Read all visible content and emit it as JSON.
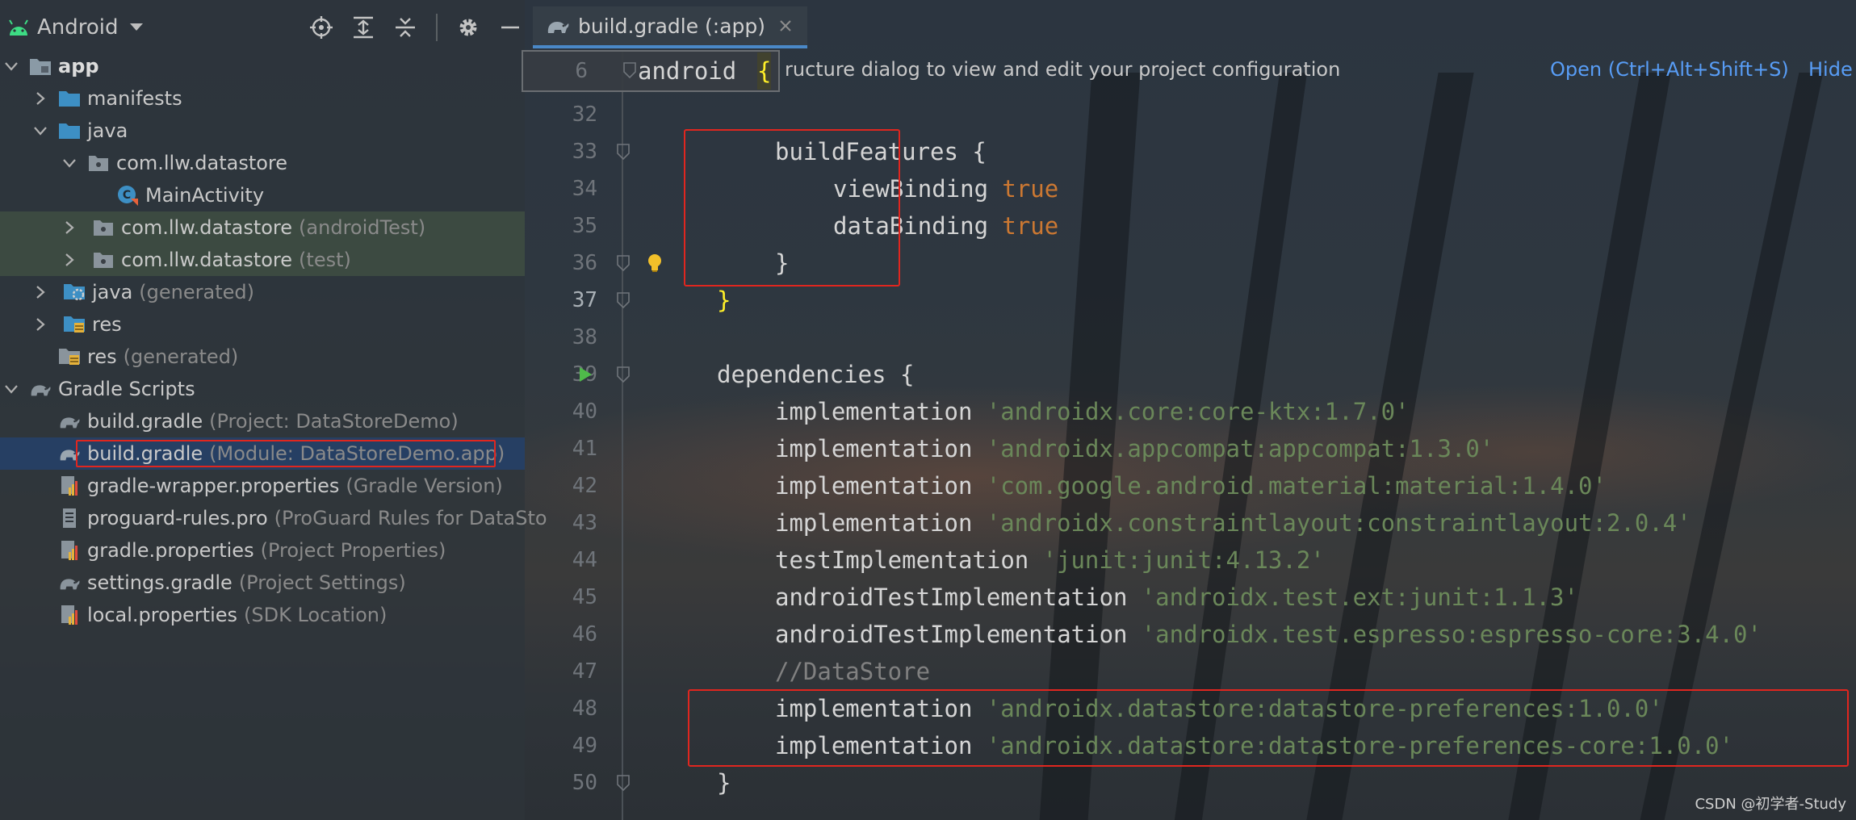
{
  "project_panel": {
    "view_label": "Android",
    "toolbar": [
      "locate-icon",
      "expand-all-icon",
      "collapse-all-icon",
      "gear-icon",
      "minimize-icon"
    ],
    "tree": [
      {
        "label": "app",
        "hint": ""
      },
      {
        "label": "manifests",
        "hint": ""
      },
      {
        "label": "java",
        "hint": ""
      },
      {
        "label": "com.llw.datastore",
        "hint": ""
      },
      {
        "label": "MainActivity",
        "hint": ""
      },
      {
        "label": "com.llw.datastore",
        "hint": "(androidTest)"
      },
      {
        "label": "com.llw.datastore",
        "hint": "(test)"
      },
      {
        "label": "java",
        "hint": "(generated)"
      },
      {
        "label": "res",
        "hint": ""
      },
      {
        "label": "res",
        "hint": "(generated)"
      },
      {
        "label": "Gradle Scripts",
        "hint": ""
      },
      {
        "label": "build.gradle",
        "hint": "(Project: DataStoreDemo)"
      },
      {
        "label": "build.gradle",
        "hint": "(Module: DataStoreDemo.app)"
      },
      {
        "label": "gradle-wrapper.properties",
        "hint": "(Gradle Version)"
      },
      {
        "label": "proguard-rules.pro",
        "hint": "(ProGuard Rules for DataSto"
      },
      {
        "label": "gradle.properties",
        "hint": "(Project Properties)"
      },
      {
        "label": "settings.gradle",
        "hint": "(Project Settings)"
      },
      {
        "label": "local.properties",
        "hint": "(SDK Location)"
      }
    ]
  },
  "editor": {
    "tab_label": "build.gradle (:app)",
    "notification": {
      "text": "ructure dialog to view and edit your project configuration",
      "open_link": "Open (Ctrl+Alt+Shift+S)",
      "hide_link": "Hide"
    },
    "sticky": {
      "line_no": "6",
      "code": "android",
      "brace": "{"
    },
    "lines": [
      {
        "no": "32",
        "tokens": []
      },
      {
        "no": "33",
        "tokens": [
          {
            "t": "buildFeatures {",
            "c": "plain"
          }
        ]
      },
      {
        "no": "34",
        "tokens": [
          {
            "t": "viewBinding ",
            "c": "plain"
          },
          {
            "t": "true",
            "c": "kw"
          }
        ]
      },
      {
        "no": "35",
        "tokens": [
          {
            "t": "dataBinding ",
            "c": "plain"
          },
          {
            "t": "true",
            "c": "kw"
          }
        ]
      },
      {
        "no": "36",
        "tokens": [
          {
            "t": "}",
            "c": "plain"
          }
        ]
      },
      {
        "no": "37",
        "tokens": [
          {
            "t": "}",
            "c": "brace"
          }
        ]
      },
      {
        "no": "38",
        "tokens": []
      },
      {
        "no": "39",
        "tokens": [
          {
            "t": "dependencies {",
            "c": "plain"
          }
        ]
      },
      {
        "no": "40",
        "tokens": [
          {
            "t": "implementation ",
            "c": "plain"
          },
          {
            "t": "'androidx.core:core-ktx:1.7.0'",
            "c": "str"
          }
        ]
      },
      {
        "no": "41",
        "tokens": [
          {
            "t": "implementation ",
            "c": "plain"
          },
          {
            "t": "'androidx.appcompat:appcompat:1.3.0'",
            "c": "str"
          }
        ]
      },
      {
        "no": "42",
        "tokens": [
          {
            "t": "implementation ",
            "c": "plain"
          },
          {
            "t": "'com.google.android.material:material:1.4.0'",
            "c": "str"
          }
        ]
      },
      {
        "no": "43",
        "tokens": [
          {
            "t": "implementation ",
            "c": "plain"
          },
          {
            "t": "'androidx.constraintlayout:constraintlayout:2.0.4'",
            "c": "str"
          }
        ]
      },
      {
        "no": "44",
        "tokens": [
          {
            "t": "testImplementation ",
            "c": "plain"
          },
          {
            "t": "'junit:junit:4.13.2'",
            "c": "str"
          }
        ]
      },
      {
        "no": "45",
        "tokens": [
          {
            "t": "androidTestImplementation ",
            "c": "plain"
          },
          {
            "t": "'androidx.test.ext:junit:1.1.3'",
            "c": "str"
          }
        ]
      },
      {
        "no": "46",
        "tokens": [
          {
            "t": "androidTestImplementation ",
            "c": "plain"
          },
          {
            "t": "'androidx.test.espresso:espresso-core:3.4.0'",
            "c": "str"
          }
        ]
      },
      {
        "no": "47",
        "tokens": [
          {
            "t": "//DataStore",
            "c": "comment"
          }
        ]
      },
      {
        "no": "48",
        "tokens": [
          {
            "t": "implementation ",
            "c": "plain"
          },
          {
            "t": "'androidx.datastore:datastore-preferences:1.0.0'",
            "c": "str"
          }
        ]
      },
      {
        "no": "49",
        "tokens": [
          {
            "t": "implementation ",
            "c": "plain"
          },
          {
            "t": "'androidx.datastore:datastore-preferences-core:1.0.0'",
            "c": "str"
          }
        ]
      },
      {
        "no": "50",
        "tokens": [
          {
            "t": "}",
            "c": "plain"
          }
        ]
      }
    ]
  },
  "watermark": "CSDN @初学者-Study",
  "colors": {
    "highlight_box": "#e0261f",
    "selection": "#263f63",
    "link": "#589df6",
    "string": "#6a8759",
    "keyword": "#cc7832"
  }
}
